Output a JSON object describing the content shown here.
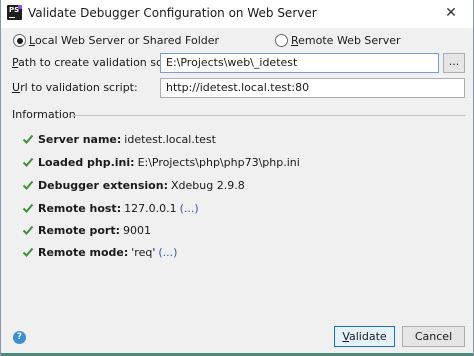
{
  "window": {
    "title": "Validate Debugger Configuration on Web Server",
    "close_glyph": "✕"
  },
  "app_icon": {
    "label": "PS"
  },
  "mode": {
    "local": {
      "label_u": "L",
      "label_rest": "ocal Web Server or Shared Folder",
      "selected": true
    },
    "remote": {
      "label_u": "R",
      "label_rest": "emote Web Server",
      "selected": false
    }
  },
  "path_field": {
    "label_u": "P",
    "label_rest": "ath to create validation script:",
    "value": "E:\\Projects\\web\\_idetest",
    "browse_label": "..."
  },
  "url_field": {
    "label_u": "U",
    "label_rest": "rl to validation script:",
    "value": "http://idetest.local.test:80"
  },
  "information": {
    "title": "Information",
    "items": [
      {
        "key": "Server name:",
        "value": "idetest.local.test",
        "link": ""
      },
      {
        "key": "Loaded php.ini:",
        "value": "E:\\Projects\\php\\php73\\php.ini",
        "link": ""
      },
      {
        "key": "Debugger extension:",
        "value": "Xdebug 2.9.8",
        "link": ""
      },
      {
        "key": "Remote host:",
        "value": "127.0.0.1",
        "link": "(...)"
      },
      {
        "key": "Remote port:",
        "value": "9001",
        "link": ""
      },
      {
        "key": "Remote mode:",
        "value": "'req'",
        "link": "(...)"
      }
    ]
  },
  "buttons": {
    "validate_u": "V",
    "validate_rest": "alidate",
    "cancel": "Cancel"
  },
  "help": {
    "glyph": "?"
  },
  "colors": {
    "check": "#3f8f3a",
    "link": "#2a5db0",
    "focus_border": "#1f6fd1"
  }
}
